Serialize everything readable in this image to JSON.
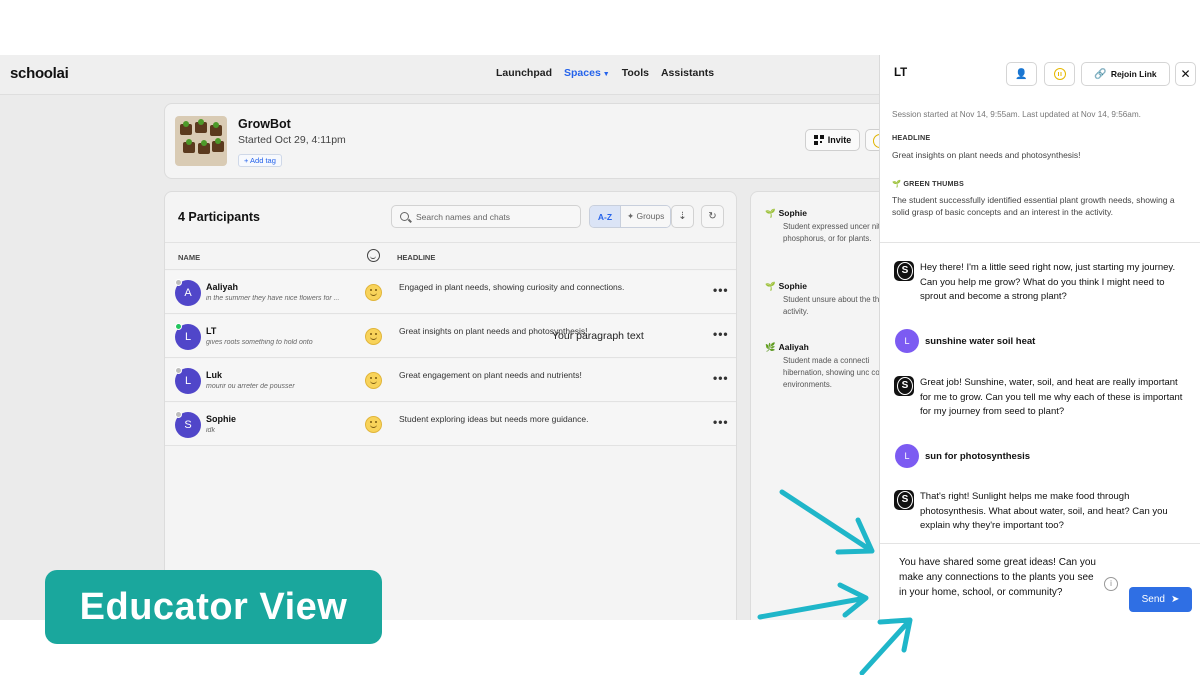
{
  "nav": {
    "logo": "schoolai",
    "links": [
      "Launchpad",
      "Spaces",
      "Tools",
      "Assistants"
    ],
    "active": "Spaces"
  },
  "activity": {
    "title": "GrowBot",
    "started": "Started Oct 29, 4:11pm",
    "add_tag": "+ Add tag",
    "invite": "Invite"
  },
  "participants": {
    "title": "4 Participants",
    "search_placeholder": "Search names and chats",
    "sort_az": "A-Z",
    "groups": "✦ Groups",
    "col_name": "NAME",
    "col_headline": "HEADLINE",
    "rows": [
      {
        "initial": "A",
        "name": "Aaliyah",
        "last": "in the summer they have nice flowers for ...",
        "headline": "Engaged in plant needs, showing curiosity and connections.",
        "online": false
      },
      {
        "initial": "L",
        "name": "LT",
        "last": "gives roots something to hold onto",
        "headline": "Great insights on plant needs and photosynthesis!",
        "online": true
      },
      {
        "initial": "L",
        "name": "Luk",
        "last": "mourir ou arreter de pousser",
        "headline": "Great engagement on plant needs and nutrients!",
        "online": false
      },
      {
        "initial": "S",
        "name": "Sophie",
        "last": "idk",
        "headline": "Student exploring ideas but needs more guidance.",
        "online": false
      }
    ]
  },
  "overlay_text": "Your paragraph text",
  "summaries": [
    {
      "name": "Sophie",
      "text": "Student expressed uncer nitrogen, phosphorus, or for plants."
    },
    {
      "name": "Sophie",
      "text": "Student unsure about the the activity."
    },
    {
      "name": "Aaliyah",
      "text": "Student made a connecti hibernation, showing unc cold environments."
    }
  ],
  "chat": {
    "title": "LT",
    "rejoin": "Rejoin Link",
    "session": "Session started at Nov 14, 9:55am. Last updated at Nov 14, 9:56am.",
    "headline_label": "HEADLINE",
    "headline": "Great insights on plant needs and photosynthesis!",
    "category_label": "🌱 GREEN THUMBS",
    "category_text": "The student successfully identified essential plant growth needs, showing a solid grasp of basic concepts and an interest in the activity.",
    "messages": [
      {
        "role": "bot",
        "text": "Hey there! I'm a little seed right now, just starting my journey. Can you help me grow? What do you think I might need to sprout and become a strong plant?"
      },
      {
        "role": "user",
        "initial": "L",
        "text": "sunshine water soil heat"
      },
      {
        "role": "bot",
        "text": "Great job! Sunshine, water, soil, and heat are really important for me to grow. Can you tell me why each of these is important for my journey from seed to plant?"
      },
      {
        "role": "user",
        "initial": "L",
        "text": "sun for photosynthesis"
      },
      {
        "role": "bot",
        "text": "That's right! Sunlight helps me make food through photosynthesis. What about water, soil, and heat? Can you explain why they're important too?"
      }
    ],
    "composer": "You have shared some great ideas! Can you make any connections to the plants you see in your home, school, or community?",
    "send": "Send"
  },
  "badge": "Educator View",
  "colors": {
    "accent": "#2563eb",
    "badge": "#1aa79d",
    "arrow": "#1fb6c9",
    "avatar": "#5046c9"
  }
}
